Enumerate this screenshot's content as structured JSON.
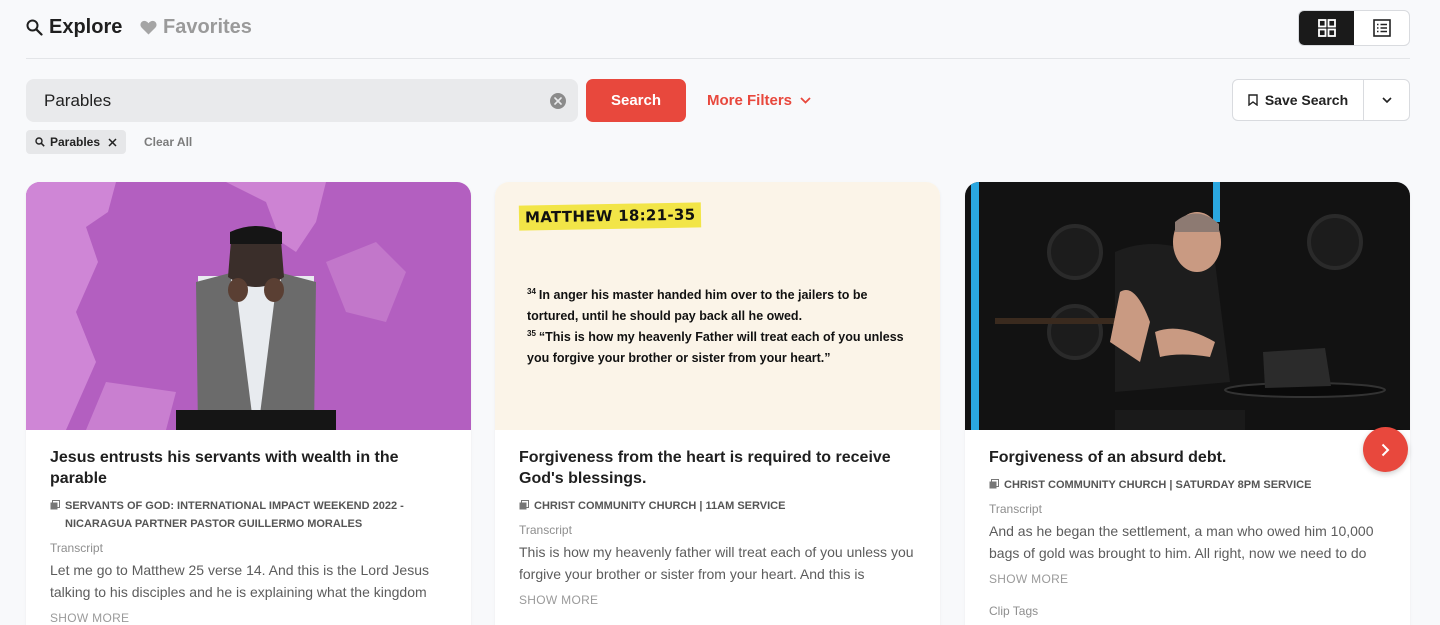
{
  "nav": {
    "explore_label": "Explore",
    "favorites_label": "Favorites"
  },
  "search": {
    "value": "Parables",
    "button_label": "Search",
    "more_filters_label": "More Filters",
    "save_search_label": "Save Search"
  },
  "chips": {
    "active_filter": "Parables",
    "clear_all_label": "Clear All"
  },
  "colors": {
    "accent": "#e8483d",
    "background": "#f8f9fb"
  },
  "cards": [
    {
      "title": "Jesus entrusts his servants with wealth in the parable",
      "source": "SERVANTS OF GOD: INTERNATIONAL IMPACT WEEKEND 2022 - NICARAGUA PARTNER PASTOR GUILLERMO MORALES",
      "transcript_label": "Transcript",
      "transcript": "Let me go to Matthew 25 verse 14. And this is the Lord Jesus talking to his disciples and he is explaining what the kingdom",
      "show_more": "SHOW MORE"
    },
    {
      "title": "Forgiveness from the heart is required to receive God's blessings.",
      "source": "CHRIST COMMUNITY CHURCH | 11AM SERVICE",
      "transcript_label": "Transcript",
      "transcript": "This is how my heavenly father will treat each of you unless you forgive your brother or sister from your heart. And this is",
      "show_more": "SHOW MORE",
      "thumb": {
        "reference": "MATTHEW 18:21-35",
        "verse1_num": "34",
        "verse1_text": "In anger his master handed him over to the jailers to be tortured, until he should pay back all he owed.",
        "verse2_num": "35",
        "verse2_text": "“This is how my heavenly Father will treat each of you unless you forgive your brother or sister from your heart.”"
      }
    },
    {
      "title": "Forgiveness of an absurd debt.",
      "source": "CHRIST COMMUNITY CHURCH | SATURDAY 8PM SERVICE",
      "transcript_label": "Transcript",
      "transcript": "And as he began the settlement, a man who owed him 10,000 bags of gold was brought to him. All right, now we need to do",
      "show_more": "SHOW MORE",
      "clip_tags_label": "Clip Tags"
    }
  ]
}
